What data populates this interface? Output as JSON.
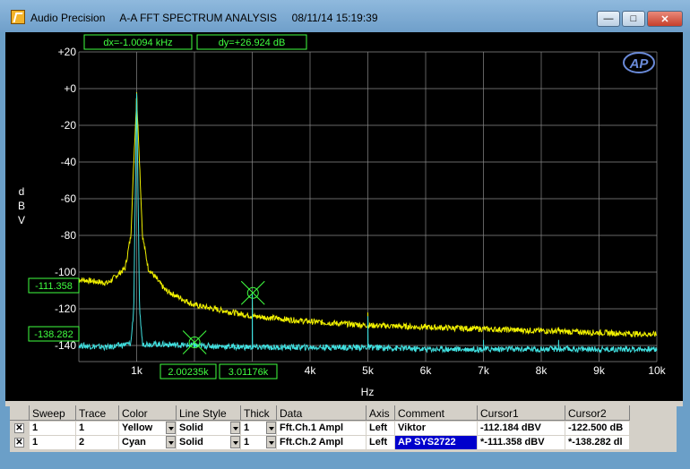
{
  "window": {
    "title": "Audio Precision     A-A FFT SPECTRUM ANALYSIS     08/11/14 15:19:39",
    "minimize_label": "—",
    "maximize_label": "□",
    "close_label": "✕"
  },
  "readouts": {
    "dx": "dx=-1.0094 kHz",
    "dy": "dy=+26.924  dB",
    "cursor1_y": "-111.358",
    "cursor2_y": "-138.282",
    "cursor1_x": "2.00235k",
    "cursor2_x": "3.01176k"
  },
  "logo": "AP",
  "chart_data": {
    "type": "line",
    "xlabel": "Hz",
    "ylabel": "dBV",
    "xlim": [
      0,
      10000
    ],
    "ylim": [
      -150,
      20
    ],
    "y_ticks": [
      "+20",
      "+0",
      "-20",
      "-40",
      "-60",
      "-80",
      "-100",
      "-120",
      "-140"
    ],
    "x_ticks": [
      "1k",
      "2k",
      "3k",
      "4k",
      "5k",
      "6k",
      "7k",
      "8k",
      "9k",
      "10k"
    ],
    "grid": true,
    "series": [
      {
        "name": "Fft.Ch.1 Ampl",
        "color": "#f0f000",
        "points": [
          [
            0,
            -104
          ],
          [
            500,
            -106
          ],
          [
            800,
            -98
          ],
          [
            900,
            -80
          ],
          [
            950,
            -40
          ],
          [
            1000,
            -5
          ],
          [
            1050,
            -40
          ],
          [
            1100,
            -80
          ],
          [
            1200,
            -98
          ],
          [
            1500,
            -110
          ],
          [
            2000,
            -118
          ],
          [
            3000,
            -124
          ],
          [
            4000,
            -127
          ],
          [
            5000,
            -129
          ],
          [
            6000,
            -130
          ],
          [
            7000,
            -131
          ],
          [
            8000,
            -132
          ],
          [
            9000,
            -133
          ],
          [
            10000,
            -134
          ]
        ],
        "spikes": [
          [
            1000,
            -2
          ],
          [
            3000,
            -112
          ],
          [
            5000,
            -122
          ],
          [
            7000,
            -130
          ],
          [
            8300,
            -130
          ]
        ]
      },
      {
        "name": "Fft.Ch.2 Ampl",
        "color": "#40e0e0",
        "points": [
          [
            0,
            -140
          ],
          [
            500,
            -141
          ],
          [
            900,
            -139
          ],
          [
            950,
            -120
          ],
          [
            1000,
            -2
          ],
          [
            1050,
            -120
          ],
          [
            1100,
            -139
          ],
          [
            2000,
            -140
          ],
          [
            3000,
            -141
          ],
          [
            4000,
            -141
          ],
          [
            5000,
            -141
          ],
          [
            6000,
            -142
          ],
          [
            7000,
            -142
          ],
          [
            8000,
            -142
          ],
          [
            9000,
            -142
          ],
          [
            10000,
            -142
          ]
        ],
        "spikes": [
          [
            2000,
            -138.3
          ],
          [
            3000,
            -111.4
          ],
          [
            5000,
            -124
          ],
          [
            7000,
            -137
          ],
          [
            8300,
            -137
          ]
        ]
      }
    ],
    "cursors": [
      {
        "x": 3011.76,
        "y": -111.358
      },
      {
        "x": 2002.35,
        "y": -138.282
      }
    ]
  },
  "table": {
    "headers": [
      "Sweep",
      "Trace",
      "Color",
      "Line Style",
      "Thick",
      "Data",
      "Axis",
      "Comment",
      "Cursor1",
      "Cursor2"
    ],
    "rows": [
      {
        "checked": "✕",
        "sweep": "1",
        "trace": "1",
        "color": "Yellow",
        "style": "Solid",
        "thick": "1",
        "data": "Fft.Ch.1 Ampl",
        "axis": "Left",
        "comment": "Viktor",
        "cursor1": "-112.184 dBV",
        "cursor2": "-122.500 dB"
      },
      {
        "checked": "✕",
        "sweep": "1",
        "trace": "2",
        "color": "Cyan",
        "style": "Solid",
        "thick": "1",
        "data": "Fft.Ch.2 Ampl",
        "axis": "Left",
        "comment": "AP SYS2722",
        "cursor1": "*-111.358 dBV",
        "cursor2": "*-138.282 dl"
      }
    ]
  }
}
